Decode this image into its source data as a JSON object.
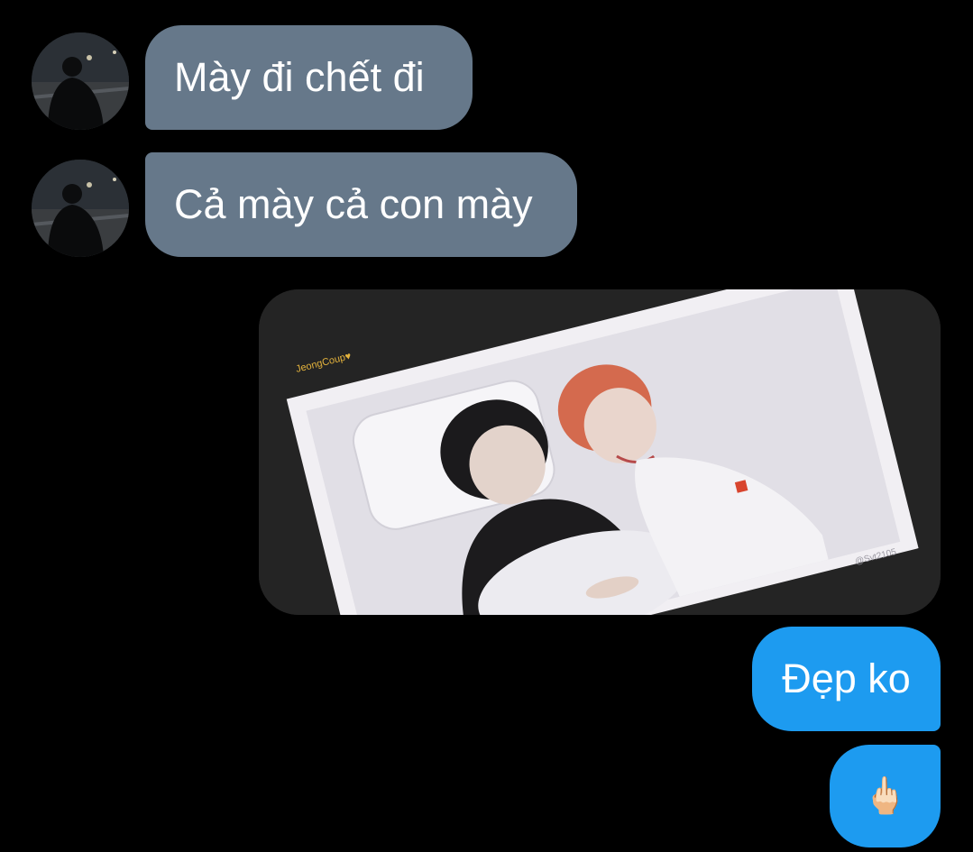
{
  "conversation": {
    "messages": [
      {
        "side": "incoming",
        "text": "Mày đi chết đi"
      },
      {
        "side": "incoming",
        "text": "Cả mày cả con mày"
      },
      {
        "side": "outgoing",
        "type": "photo",
        "watermark_left": "JeongCoup♥",
        "watermark_right": "@Svt2105"
      },
      {
        "side": "outgoing",
        "text": "Đẹp ko"
      },
      {
        "side": "outgoing",
        "text": "🖕🏻"
      }
    ]
  },
  "colors": {
    "background": "#000000",
    "incoming_bubble": "#66788a",
    "outgoing_bubble": "#1d9bf0"
  }
}
